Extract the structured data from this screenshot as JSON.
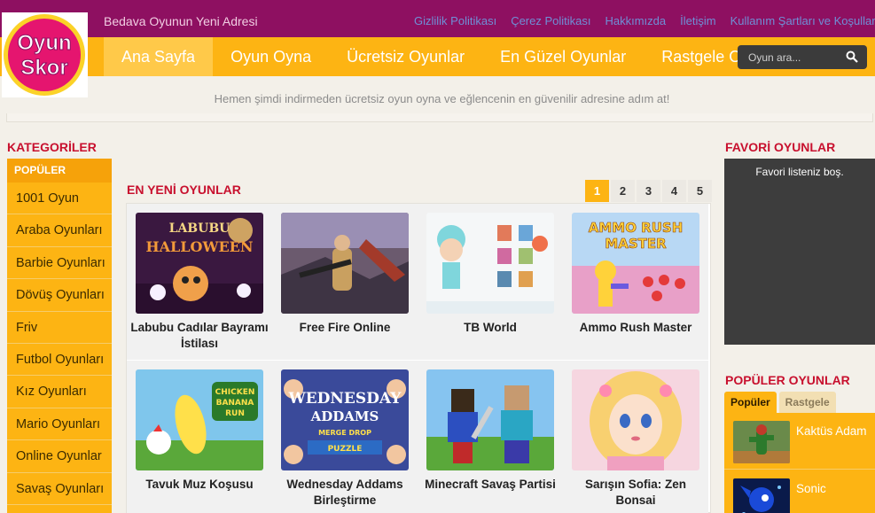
{
  "header": {
    "tagline": "Bedava Oyunun Yeni Adresi",
    "links": [
      "Gizlilik Politikası",
      "Çerez Politikası",
      "Hakkımızda",
      "İletişim",
      "Kullanım Şartları ve Koşulları"
    ],
    "logo_line1": "Oyun",
    "logo_line2": "Skor"
  },
  "nav": {
    "items": [
      "Ana Sayfa",
      "Oyun Oyna",
      "Ücretsiz Oyunlar",
      "En Güzel Oyunlar",
      "Rastgele Oyun"
    ],
    "active_index": 0
  },
  "search": {
    "placeholder": "Oyun ara..."
  },
  "subtitle": "Hemen şimdi indirmeden ücretsiz oyun oyna ve eğlencenin en güvenilir adresine adım at!",
  "categories": {
    "title": "KATEGORİLER",
    "group": "POPÜLER",
    "items": [
      "1001 Oyun",
      "Araba Oyunları",
      "Barbie Oyunları",
      "Dövüş Oyunları",
      "Friv",
      "Futbol Oyunları",
      "Kız Oyunları",
      "Mario Oyunları",
      "Online Oyunlar",
      "Savaş Oyunları"
    ]
  },
  "newest": {
    "title": "EN YENİ OYUNLAR",
    "pages": [
      "1",
      "2",
      "3",
      "4",
      "5"
    ],
    "current_page": "1",
    "games": [
      {
        "title": "Labubu Cadılar Bayramı İstilası",
        "thumb_text": "LABUBU HALLOWEEN",
        "icon": "labubu-halloween-thumbnail"
      },
      {
        "title": "Free Fire Online",
        "thumb_text": "",
        "icon": "free-fire-thumbnail"
      },
      {
        "title": "TB World",
        "thumb_text": "",
        "icon": "tb-world-thumbnail"
      },
      {
        "title": "Ammo Rush Master",
        "thumb_text": "AMMO RUSH MASTER",
        "icon": "ammo-rush-thumbnail"
      },
      {
        "title": "Tavuk Muz Koşusu",
        "thumb_text": "CHICKEN BANANA RUN",
        "icon": "chicken-banana-thumbnail"
      },
      {
        "title": "Wednesday Addams Birleştirme",
        "thumb_text": "WEDNESDAY ADDAMS MERGE DROP PUZZLE",
        "icon": "wednesday-thumbnail"
      },
      {
        "title": "Minecraft Savaş Partisi",
        "thumb_text": "",
        "icon": "minecraft-thumbnail"
      },
      {
        "title": "Sarışın Sofia: Zen Bonsai",
        "thumb_text": "",
        "icon": "sofia-thumbnail"
      }
    ]
  },
  "favorites": {
    "title": "FAVORİ OYUNLAR",
    "empty_text": "Favori listeniz boş."
  },
  "popular": {
    "title": "POPÜLER OYUNLAR",
    "tabs": [
      "Popüler",
      "Rastgele"
    ],
    "items": [
      {
        "name": "Kaktüs Adam",
        "icon": "cactus-man-thumbnail"
      },
      {
        "name": "Sonic",
        "icon": "sonic-thumbnail"
      }
    ]
  },
  "colors": {
    "header": "#8e1061",
    "nav": "#fdb413",
    "accent_red": "#c8102e"
  }
}
